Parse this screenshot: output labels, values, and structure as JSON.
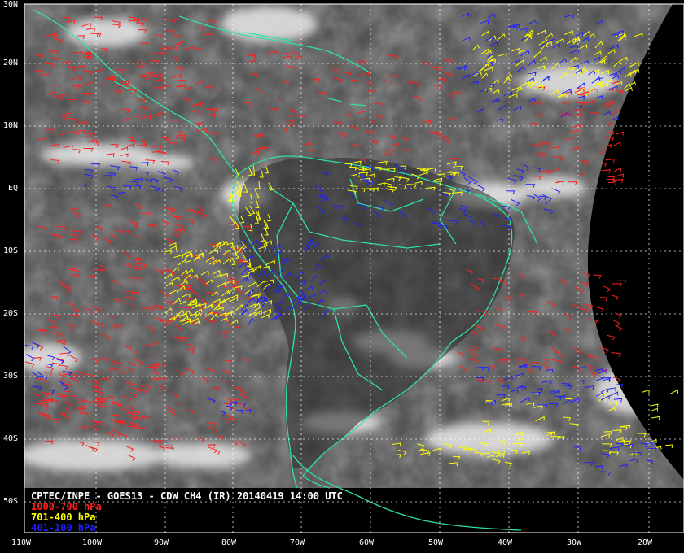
{
  "title": "CPTEC/INPE - GOES13 - CDW CH4 (IR) 20140419 14:00 UTC",
  "legend": [
    {
      "label": "1000-700 hPa",
      "color": "#ff2020"
    },
    {
      "label": "701-400 hPa",
      "color": "#ffff00"
    },
    {
      "label": "401-100 hPa",
      "color": "#2020ff"
    }
  ],
  "colors": {
    "coastline": "#30e0a0",
    "grid": "#ffffff",
    "space": "#000000",
    "cloud_bright": "#f0f0f0",
    "surface_dark": "#3a3a3a"
  },
  "lat_labels": [
    "30N",
    "20N",
    "10N",
    "EQ",
    "10S",
    "20S",
    "30S",
    "40S",
    "50S"
  ],
  "lon_labels": [
    "110W",
    "100W",
    "90W",
    "80W",
    "70W",
    "60W",
    "50W",
    "40W",
    "30W",
    "20W"
  ],
  "map": {
    "lon_range": [
      -110,
      -15
    ],
    "lat_range": [
      -55,
      30
    ]
  }
}
